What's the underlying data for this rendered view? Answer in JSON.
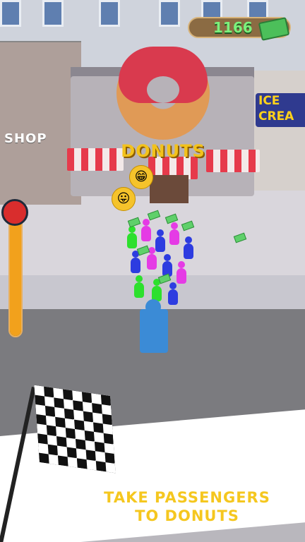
{
  "hud": {
    "money_value": "1166",
    "money_icon": "cash-stack-icon",
    "progress_fraction": 0.95
  },
  "scene_labels": {
    "shop_sign": "SHOP",
    "donut_sign": "DONUTS",
    "ice_cream_sign_line1": "ICE",
    "ice_cream_sign_line2": "CREA"
  },
  "caption": {
    "line1": "TAKE PASSENGERS",
    "line2": "TO DONUTS"
  },
  "colors": {
    "accent_yellow": "#f5c71f",
    "money_green": "#7cf07c",
    "road_gray": "#7b7b7f",
    "awning_red": "#e63a4b"
  },
  "icons": [
    "cash-stack-icon",
    "grin-emoji-icon",
    "tongue-emoji-icon",
    "finish-flag-icon"
  ]
}
